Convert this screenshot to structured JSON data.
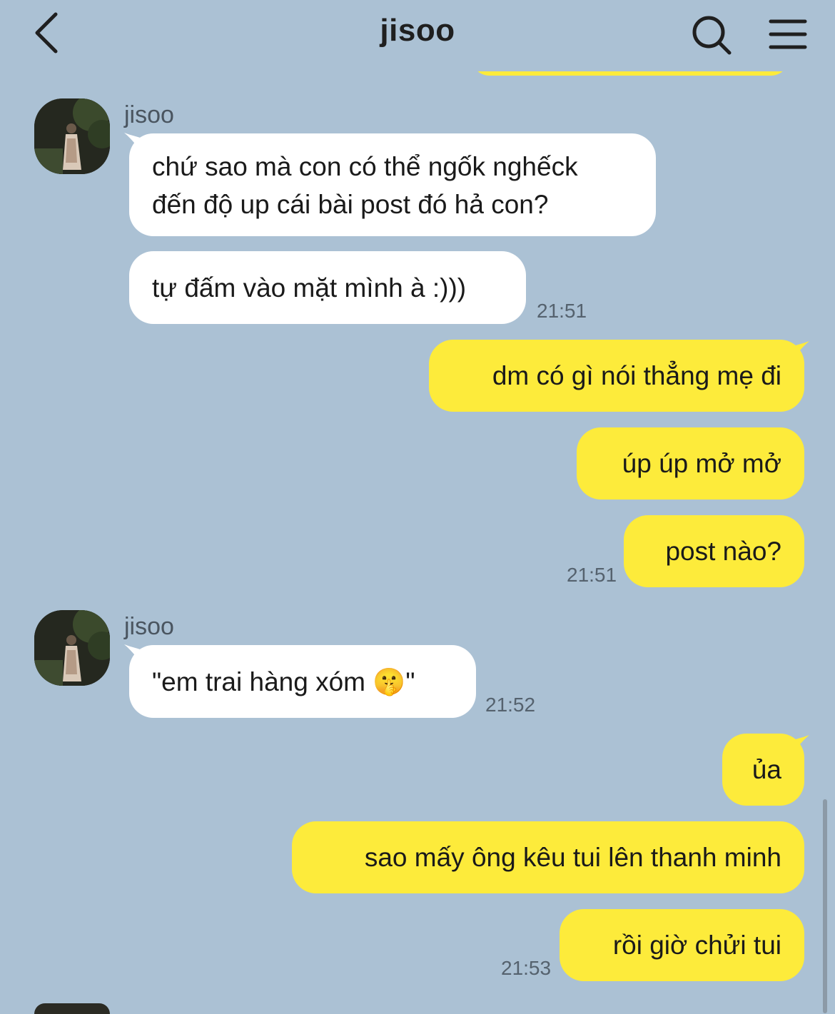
{
  "header": {
    "title": "jisoo",
    "back_icon": "chevron-left-icon",
    "search_icon": "search-icon",
    "menu_icon": "hamburger-menu-icon"
  },
  "colors": {
    "background": "#abc1d4",
    "incoming_bubble": "#ffffff",
    "outgoing_bubble": "#fdeb3b"
  },
  "messages": {
    "group1": {
      "sender": "jisoo",
      "line1": "chứ sao mà con có thể ngốk nghếck",
      "line2": "đến độ up cái bài post đó hả con?",
      "msg2": "tự đấm vào mặt mình à :)))",
      "time": "21:51"
    },
    "group2": {
      "msg1": "dm có gì nói thẳng mẹ đi",
      "msg2": "úp úp mở mở",
      "msg3": "post nào?",
      "time": "21:51"
    },
    "group3": {
      "sender": "jisoo",
      "msg1": "\"em trai hàng xóm 🤫\"",
      "time": "21:52"
    },
    "group4": {
      "msg1": "ủa",
      "msg2": "sao mấy ông kêu tui lên thanh minh",
      "msg3": "rồi giờ chửi tui",
      "time": "21:53"
    }
  }
}
